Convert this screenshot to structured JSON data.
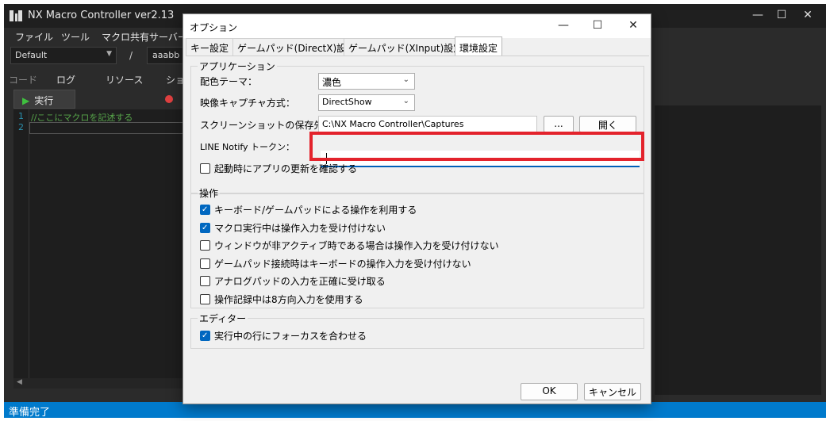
{
  "main_window": {
    "title": "NX Macro Controller ver2.13",
    "window_controls": {
      "minimize": "—",
      "maximize": "☐",
      "close": "✕"
    },
    "menu": [
      "ファイル",
      "ツール",
      "マクロ共有サーバー"
    ],
    "profile_value": "Default",
    "separator": "/",
    "name_value": "aaabb",
    "tabs": [
      "コード",
      "ログ",
      "リソース",
      "ショー"
    ],
    "run_label": "実行",
    "line_numbers": [
      "1",
      "2"
    ],
    "code_line_1": "//ここにマクロを記述する",
    "status": "準備完了"
  },
  "dialog": {
    "title": "オプション",
    "controls": {
      "minimize": "—",
      "maximize": "☐",
      "close": "✕"
    },
    "tabs": [
      "キー設定",
      "ゲームパッド(DirectX)設定",
      "ゲームパッド(XInput)設定",
      "環境設定"
    ],
    "active_tab": "環境設定",
    "app_group": {
      "legend": "アプリケーション",
      "theme_label": "配色テーマ：",
      "theme_value": "濃色",
      "capture_label": "映像キャプチャ方式：",
      "capture_value": "DirectShow",
      "screenshot_label": "スクリーンショットの保存先：",
      "screenshot_path": "C:\\NX Macro Controller\\Captures",
      "browse_label": "...",
      "open_label": "開く",
      "line_token_label": "LINE Notify トークン：",
      "line_token_value": "",
      "update_check_label": "起動時にアプリの更新を確認する",
      "update_check_checked": false
    },
    "op_group": {
      "legend": "操作",
      "options": [
        {
          "label": "キーボード/ゲームパッドによる操作を利用する",
          "checked": true
        },
        {
          "label": "マクロ実行中は操作入力を受け付けない",
          "checked": true
        },
        {
          "label": "ウィンドウが非アクティブ時である場合は操作入力を受け付けない",
          "checked": false
        },
        {
          "label": "ゲームパッド接続時はキーボードの操作入力を受け付けない",
          "checked": false
        },
        {
          "label": "アナログパッドの入力を正確に受け取る",
          "checked": false
        },
        {
          "label": "操作記録中は8方向入力を使用する",
          "checked": false
        }
      ]
    },
    "editor_group": {
      "legend": "エディター",
      "options": [
        {
          "label": "実行中の行にフォーカスを合わせる",
          "checked": true
        }
      ]
    },
    "ok_label": "OK",
    "cancel_label": "キャンセル"
  },
  "colors": {
    "highlight": "#e3232c",
    "accent": "#0067c0",
    "status_bar": "#007acc"
  }
}
